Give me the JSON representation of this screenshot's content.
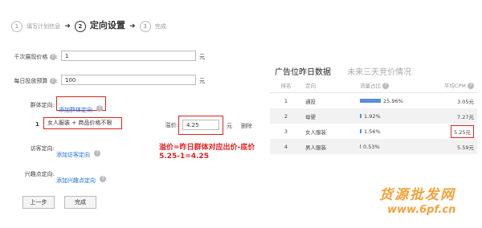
{
  "steps": [
    {
      "num": "1",
      "label": "填写计划信息"
    },
    {
      "num": "2",
      "label": "定向设置"
    },
    {
      "num": "3",
      "label": "完成"
    }
  ],
  "form": {
    "cpm_label": "千次展现价格",
    "cpm_value": "1",
    "cpm_unit": "元",
    "budget_label": "每日投放预算",
    "budget_value": "100",
    "budget_unit": "元",
    "group_label": "群体定向",
    "add_group_link": "添加群体定向",
    "group_index": "1",
    "group_tag": "女人服装 + 商品价格不限",
    "premium_label": "溢价",
    "premium_value": "4.25",
    "premium_unit": "元",
    "delete_label": "删除",
    "visitor_label": "访客定向",
    "add_visitor_link": "添加访客定向",
    "interest_label": "兴趣点定向",
    "add_interest_link": "添加兴趣点定向",
    "prev_button": "上一步",
    "finish_button": "完成"
  },
  "annotation": {
    "line1": "溢价=昨日群体对应出价-底价",
    "line2": "5.25-1=4.25"
  },
  "right_panel": {
    "tab_active": "广告位昨日数据",
    "tab_inactive": "未来三天竞价情况",
    "columns": [
      "排名",
      "定向",
      "流量占比",
      "平均CPM"
    ],
    "rows": [
      {
        "rank": "1",
        "target": "通投",
        "share": "25.96%",
        "share_pct": 25.96,
        "cpm": "3.05元"
      },
      {
        "rank": "2",
        "target": "母婴",
        "share": "1.92%",
        "share_pct": 1.92,
        "cpm": "7.27元"
      },
      {
        "rank": "3",
        "target": "女人服装",
        "share": "1.56%",
        "share_pct": 1.56,
        "cpm": "5.25元"
      },
      {
        "rank": "4",
        "target": "男人服装",
        "share": "0.53%",
        "share_pct": 0.53,
        "cpm": "5.59元"
      }
    ]
  },
  "watermark": {
    "line1": "货源批发网",
    "line2": "www.6pf.cn"
  },
  "colors": {
    "link": "#1a6ed8",
    "highlight": "#d22222",
    "annotation": "#e02020",
    "bar": "#5b8fd6",
    "watermark": "#f4a23a"
  }
}
